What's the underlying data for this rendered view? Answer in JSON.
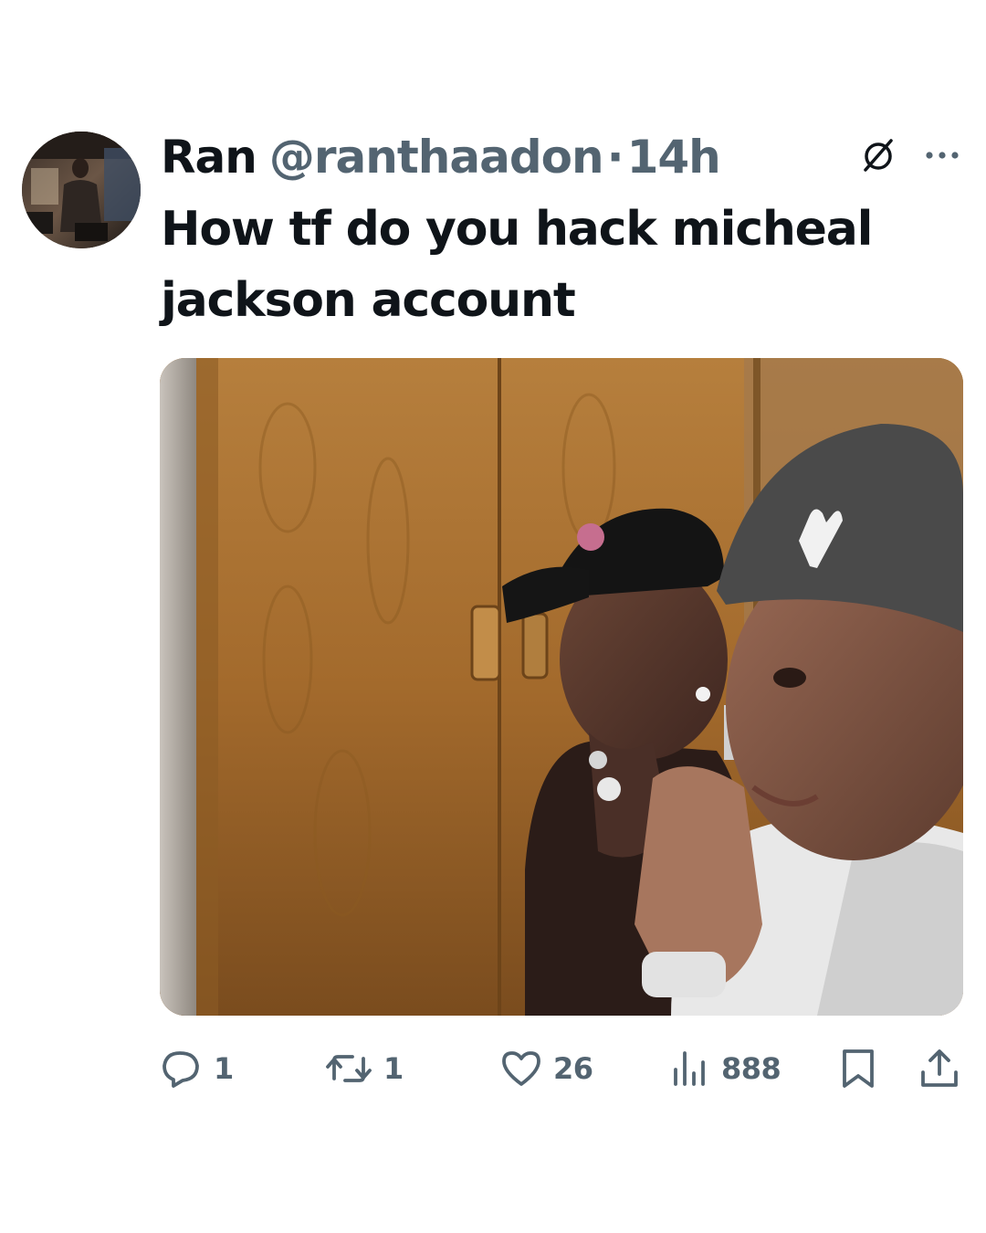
{
  "tweet": {
    "author_name": "Ran",
    "author_handle": "@ranthaadon",
    "separator": "·",
    "time": "14h",
    "text": "How tf do you hack micheal jackson account",
    "stats": {
      "replies": "1",
      "retweets": "1",
      "likes": "26",
      "views": "888"
    }
  },
  "icons": {
    "grok": "grok-icon",
    "more": "more-icon",
    "reply": "reply-icon",
    "retweet": "retweet-icon",
    "like": "heart-icon",
    "views": "views-icon",
    "bookmark": "bookmark-icon",
    "share": "share-icon"
  },
  "colors": {
    "text_primary": "#0f1419",
    "text_secondary": "#536471",
    "background": "#ffffff"
  }
}
